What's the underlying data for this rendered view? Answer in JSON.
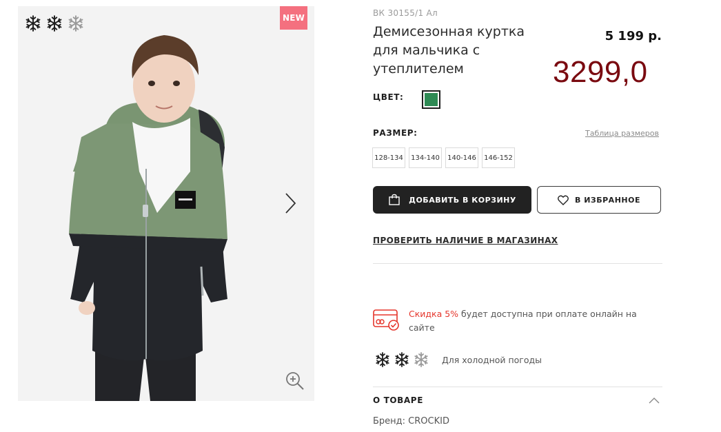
{
  "gallery": {
    "badge": "NEW",
    "snowflakes": [
      {
        "name": "snowflake-icon",
        "active": true
      },
      {
        "name": "snowflake-icon",
        "active": true
      },
      {
        "name": "snowflake-icon",
        "active": false
      }
    ],
    "next_icon": "chevron-right-icon",
    "zoom_icon": "zoom-in-icon"
  },
  "product": {
    "article": "ВК 30155/1 Ал",
    "title": "Демисезонная куртка для мальчика с утеплителем",
    "old_price": "5 199 р.",
    "new_price": "3299,0",
    "price_color": "#7a0a10"
  },
  "color": {
    "label": "ЦВЕТ:",
    "selected": "#2e8a54"
  },
  "size": {
    "label": "РАЗМЕР:",
    "table_link": "Таблица размеров",
    "options": [
      "128-134",
      "134-140",
      "140-146",
      "146-152"
    ]
  },
  "actions": {
    "cart_label": "ДОБАВИТЬ В КОРЗИНУ",
    "cart_icon": "shopping-bag-icon",
    "fav_label": "В ИЗБРАННОЕ",
    "fav_icon": "heart-icon",
    "check_stores": "ПРОВЕРИТЬ НАЛИЧИЕ В МАГАЗИНАХ"
  },
  "promo": {
    "icon": "card-discount-icon",
    "highlight": "Скидка 5%",
    "text": " будет доступна при оплате онлайн на сайте",
    "accent": "#e5352b"
  },
  "weather": {
    "level": 2,
    "max": 3,
    "text": "Для холодной погоды"
  },
  "about": {
    "heading": "О ТОВАРЕ",
    "brand_line": "Бренд: CROCKID"
  }
}
